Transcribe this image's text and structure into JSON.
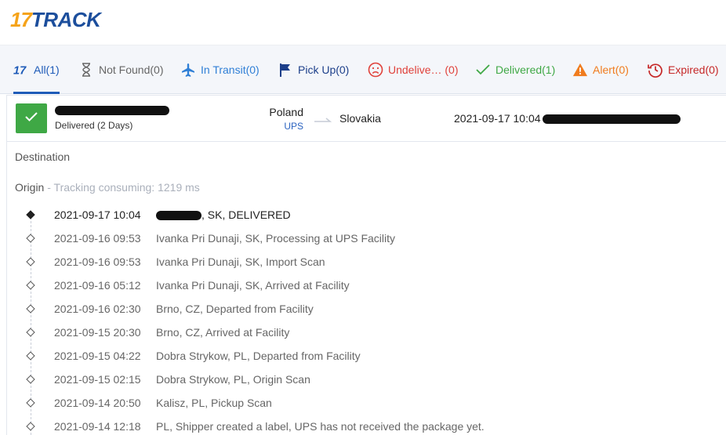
{
  "brand": {
    "logo_number": "17",
    "logo_word": "TRACK"
  },
  "tabs": [
    {
      "label": "All(1)",
      "color": "#1e5bb8",
      "icon": "seventeen-logo-icon",
      "active": true
    },
    {
      "label": "Not Found(0)",
      "color": "#666666",
      "icon": "hourglass-icon"
    },
    {
      "label": "In Transit(0)",
      "color": "#2f7fd6",
      "icon": "airplane-icon"
    },
    {
      "label": "Pick Up(0)",
      "color": "#1c3f8a",
      "icon": "flag-icon"
    },
    {
      "label": "Undelive… (0)",
      "color": "#e0413a",
      "icon": "sad-face-icon"
    },
    {
      "label": "Delivered(1)",
      "color": "#3fa845",
      "icon": "checkmark-icon"
    },
    {
      "label": "Alert(0)",
      "color": "#f07c1e",
      "icon": "warning-icon"
    },
    {
      "label": "Expired(0)",
      "color": "#c62828",
      "icon": "clock-history-icon"
    }
  ],
  "shipment": {
    "status_color": "#3fa845",
    "delivered_text": "Delivered (2 Days)",
    "origin_country": "Poland",
    "carrier": "UPS",
    "destination_country": "Slovakia",
    "last_event_time": "2021-09-17 10:04"
  },
  "details": {
    "destination_label": "Destination",
    "origin_label": "Origin",
    "tracking_consuming": " - Tracking consuming: 1219 ms"
  },
  "events": [
    {
      "time": "2021-09-17 10:04",
      "desc": ", SK, DELIVERED",
      "redacted": true
    },
    {
      "time": "2021-09-16 09:53",
      "desc": "Ivanka Pri Dunaji, SK, Processing at UPS Facility"
    },
    {
      "time": "2021-09-16 09:53",
      "desc": "Ivanka Pri Dunaji, SK, Import Scan"
    },
    {
      "time": "2021-09-16 05:12",
      "desc": "Ivanka Pri Dunaji, SK, Arrived at Facility"
    },
    {
      "time": "2021-09-16 02:30",
      "desc": "Brno, CZ, Departed from Facility"
    },
    {
      "time": "2021-09-15 20:30",
      "desc": "Brno, CZ, Arrived at Facility"
    },
    {
      "time": "2021-09-15 04:22",
      "desc": "Dobra Strykow, PL, Departed from Facility"
    },
    {
      "time": "2021-09-15 02:15",
      "desc": "Dobra Strykow, PL, Origin Scan"
    },
    {
      "time": "2021-09-14 20:50",
      "desc": "Kalisz, PL, Pickup Scan"
    },
    {
      "time": "2021-09-14 12:18",
      "desc": "PL, Shipper created a label, UPS has not received the package yet."
    }
  ]
}
